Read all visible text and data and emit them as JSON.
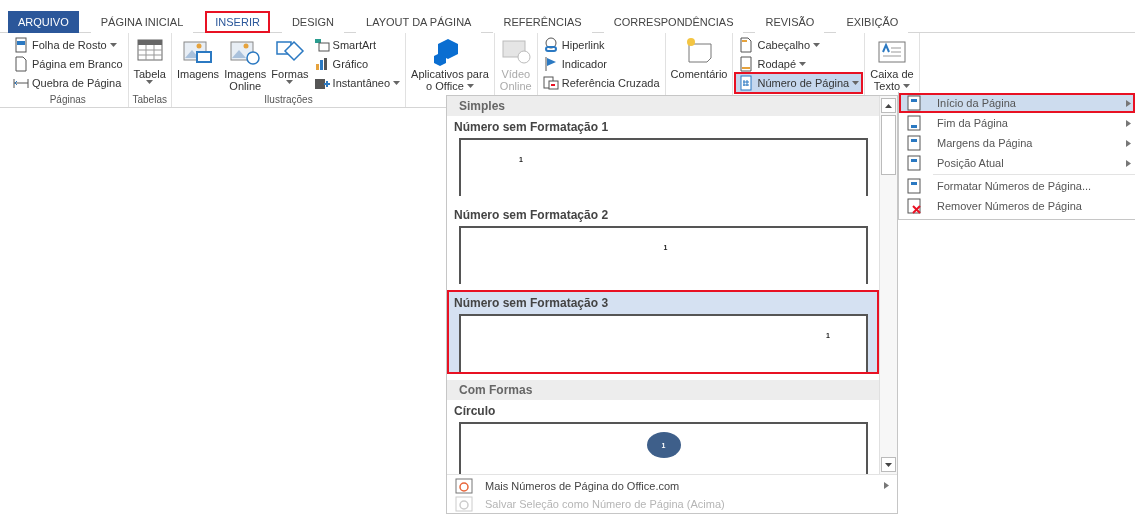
{
  "tabs": [
    {
      "label": "ARQUIVO",
      "kind": "file",
      "selected": false,
      "highlighted": false
    },
    {
      "label": "PÁGINA INICIAL",
      "kind": "tab",
      "selected": false,
      "highlighted": false
    },
    {
      "label": "INSERIR",
      "kind": "tab",
      "selected": true,
      "highlighted": true
    },
    {
      "label": "DESIGN",
      "kind": "tab",
      "selected": false,
      "highlighted": false
    },
    {
      "label": "LAYOUT DA PÁGINA",
      "kind": "tab",
      "selected": false,
      "highlighted": false
    },
    {
      "label": "REFERÊNCIAS",
      "kind": "tab",
      "selected": false,
      "highlighted": false
    },
    {
      "label": "CORRESPONDÊNCIAS",
      "kind": "tab",
      "selected": false,
      "highlighted": false
    },
    {
      "label": "REVISÃO",
      "kind": "tab",
      "selected": false,
      "highlighted": false
    },
    {
      "label": "EXIBIÇÃO",
      "kind": "tab",
      "selected": false,
      "highlighted": false
    }
  ],
  "ribbon": [
    {
      "label": "Páginas",
      "columns": [
        {
          "kind": "stack",
          "items": [
            {
              "label": "Folha de Rosto",
              "dropdown": true,
              "selected": false,
              "highlighted": false
            },
            {
              "label": "Página em Branco",
              "dropdown": false,
              "selected": false,
              "highlighted": false
            },
            {
              "label": "Quebra de Página",
              "dropdown": false,
              "selected": false,
              "highlighted": false
            }
          ]
        }
      ]
    },
    {
      "label": "Tabelas",
      "columns": [
        {
          "kind": "large",
          "lines": [
            "Tabela"
          ],
          "dropdown": true,
          "disabled": false
        }
      ]
    },
    {
      "label": "Ilustrações",
      "columns": [
        {
          "kind": "large",
          "lines": [
            "Imagens"
          ],
          "dropdown": false,
          "disabled": false
        },
        {
          "kind": "large",
          "lines": [
            "Imagens",
            "Online"
          ],
          "dropdown": false,
          "disabled": false
        },
        {
          "kind": "large",
          "lines": [
            "Formas"
          ],
          "dropdown": true,
          "disabled": false
        },
        {
          "kind": "stack",
          "items": [
            {
              "label": "SmartArt",
              "dropdown": false,
              "selected": false,
              "highlighted": false
            },
            {
              "label": "Gráfico",
              "dropdown": false,
              "selected": false,
              "highlighted": false
            },
            {
              "label": "Instantâneo",
              "dropdown": true,
              "selected": false,
              "highlighted": false
            }
          ]
        }
      ]
    },
    {
      "columns": [
        {
          "kind": "large",
          "lines": [
            "Aplicativos para",
            "o Office"
          ],
          "dropdown": true,
          "disabled": false
        }
      ]
    },
    {
      "columns": [
        {
          "kind": "large",
          "lines": [
            "Vídeo",
            "Online"
          ],
          "dropdown": false,
          "disabled": true
        }
      ]
    },
    {
      "columns": [
        {
          "kind": "stack",
          "items": [
            {
              "label": "Hiperlink",
              "dropdown": false,
              "selected": false,
              "highlighted": false
            },
            {
              "label": "Indicador",
              "dropdown": false,
              "selected": false,
              "highlighted": false
            },
            {
              "label": "Referência Cruzada",
              "dropdown": false,
              "selected": false,
              "highlighted": false
            }
          ]
        }
      ]
    },
    {
      "columns": [
        {
          "kind": "large",
          "lines": [
            "Comentário"
          ],
          "dropdown": false,
          "disabled": false
        }
      ]
    },
    {
      "columns": [
        {
          "kind": "stack",
          "items": [
            {
              "label": "Cabeçalho",
              "dropdown": true,
              "selected": false,
              "highlighted": false
            },
            {
              "label": "Rodapé",
              "dropdown": true,
              "selected": false,
              "highlighted": false
            },
            {
              "label": "Número de Página",
              "dropdown": true,
              "selected": true,
              "highlighted": true
            }
          ]
        }
      ]
    },
    {
      "columns": [
        {
          "kind": "large",
          "lines": [
            "Caixa de",
            "Texto"
          ],
          "dropdown": true,
          "disabled": false
        }
      ]
    }
  ],
  "gallery": {
    "sections": [
      {
        "title": "Simples",
        "items": [
          {
            "title": "Número sem Formatação 1",
            "kind": "left",
            "number": "1",
            "selected": false,
            "highlighted": false
          },
          {
            "title": "Número sem Formatação 2",
            "kind": "center",
            "number": "1",
            "selected": false,
            "highlighted": false
          },
          {
            "title": "Número sem Formatação 3",
            "kind": "right",
            "number": "1",
            "selected": true,
            "highlighted": true
          }
        ]
      },
      {
        "title": "Com Formas",
        "items": [
          {
            "title": "Círculo",
            "kind": "circle",
            "number": "1",
            "selected": false,
            "highlighted": false
          }
        ]
      }
    ],
    "footer": [
      {
        "label": "Mais Números de Página do Office.com",
        "submenu": true,
        "disabled": false
      },
      {
        "label": "Salvar Seleção como Número de Página (Acima)",
        "submenu": false,
        "disabled": true
      }
    ]
  },
  "submenu": [
    {
      "label": "Início da Página",
      "submenu": true,
      "selected": true,
      "highlighted": true
    },
    {
      "label": "Fim da Página",
      "submenu": true,
      "selected": false,
      "highlighted": false
    },
    {
      "label": "Margens da Página",
      "submenu": true,
      "selected": false,
      "highlighted": false
    },
    {
      "label": "Posição Atual",
      "submenu": true,
      "selected": false,
      "highlighted": false
    },
    {
      "label": "Formatar Números de Página...",
      "submenu": false,
      "selected": false,
      "highlighted": false
    },
    {
      "label": "Remover Números de Página",
      "submenu": false,
      "selected": false,
      "highlighted": false
    }
  ]
}
